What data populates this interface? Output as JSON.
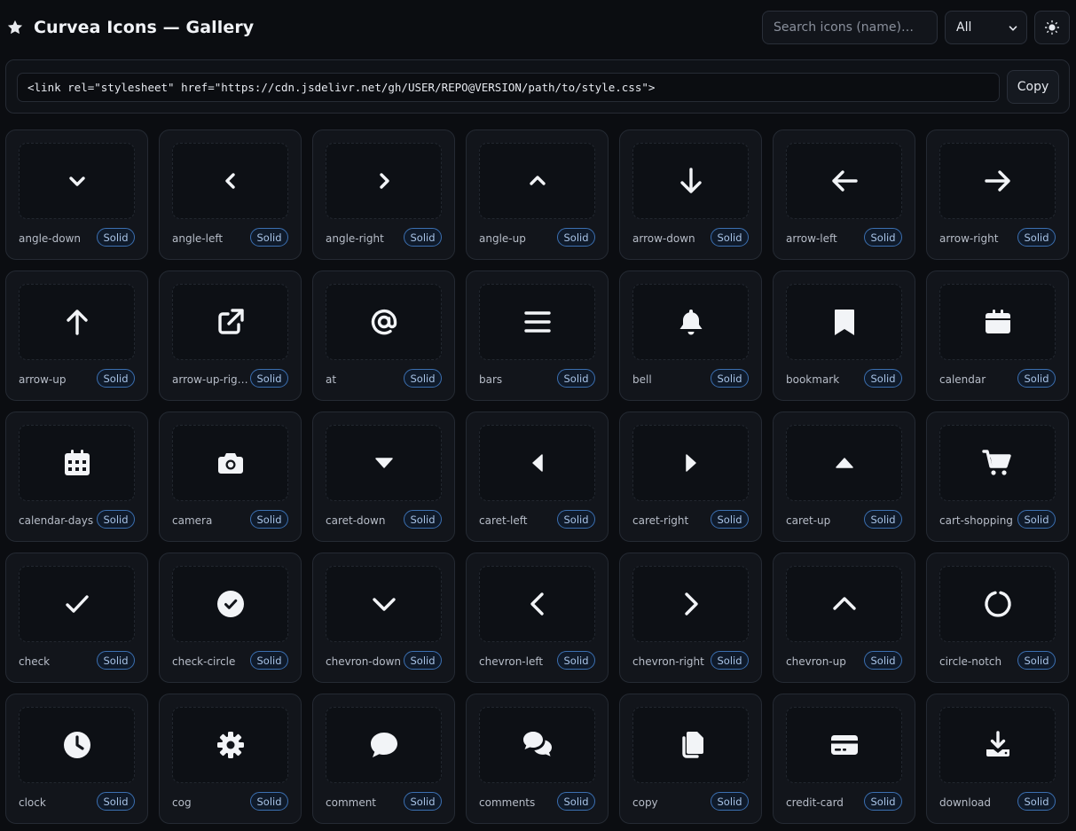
{
  "header": {
    "title": "Curvea Icons — Gallery",
    "search_placeholder": "Search icons (name)…",
    "filter_value": "All"
  },
  "cdn": {
    "snippet": "<link rel=\"stylesheet\" href=\"https://cdn.jsdelivr.net/gh/USER/REPO@VERSION/path/to/style.css\">",
    "copy_label": "Copy"
  },
  "icons": [
    {
      "name": "angle-down",
      "style": "Solid"
    },
    {
      "name": "angle-left",
      "style": "Solid"
    },
    {
      "name": "angle-right",
      "style": "Solid"
    },
    {
      "name": "angle-up",
      "style": "Solid"
    },
    {
      "name": "arrow-down",
      "style": "Solid"
    },
    {
      "name": "arrow-left",
      "style": "Solid"
    },
    {
      "name": "arrow-right",
      "style": "Solid"
    },
    {
      "name": "arrow-up",
      "style": "Solid"
    },
    {
      "name": "arrow-up-right-from-square",
      "style": "Solid"
    },
    {
      "name": "at",
      "style": "Solid"
    },
    {
      "name": "bars",
      "style": "Solid"
    },
    {
      "name": "bell",
      "style": "Solid"
    },
    {
      "name": "bookmark",
      "style": "Solid"
    },
    {
      "name": "calendar",
      "style": "Solid"
    },
    {
      "name": "calendar-days",
      "style": "Solid"
    },
    {
      "name": "camera",
      "style": "Solid"
    },
    {
      "name": "caret-down",
      "style": "Solid"
    },
    {
      "name": "caret-left",
      "style": "Solid"
    },
    {
      "name": "caret-right",
      "style": "Solid"
    },
    {
      "name": "caret-up",
      "style": "Solid"
    },
    {
      "name": "cart-shopping",
      "style": "Solid"
    },
    {
      "name": "check",
      "style": "Solid"
    },
    {
      "name": "check-circle",
      "style": "Solid"
    },
    {
      "name": "chevron-down",
      "style": "Solid"
    },
    {
      "name": "chevron-left",
      "style": "Solid"
    },
    {
      "name": "chevron-right",
      "style": "Solid"
    },
    {
      "name": "chevron-up",
      "style": "Solid"
    },
    {
      "name": "circle-notch",
      "style": "Solid"
    },
    {
      "name": "clock",
      "style": "Solid"
    },
    {
      "name": "cog",
      "style": "Solid"
    },
    {
      "name": "comment",
      "style": "Solid"
    },
    {
      "name": "comments",
      "style": "Solid"
    },
    {
      "name": "copy",
      "style": "Solid"
    },
    {
      "name": "credit-card",
      "style": "Solid"
    },
    {
      "name": "download",
      "style": "Solid"
    }
  ]
}
